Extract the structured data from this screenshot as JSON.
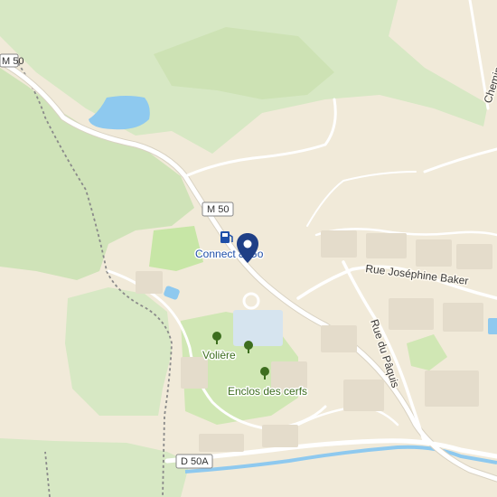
{
  "map": {
    "colors": {
      "land": "#f1ead9",
      "forest": "#d7e8c4",
      "forest_dark": "#c9e0b1",
      "park": "#d0e7b4",
      "water": "#8ec9ef",
      "road": "#ffffff",
      "pin": "#1f3f86",
      "station": "#1f4fa8",
      "poi_green": "#3d6e1f"
    },
    "road_shields": {
      "m50_top": "M 50",
      "m50_mid": "M 50",
      "d50a": "D 50A"
    },
    "station": {
      "icon": "fuel-pump-icon",
      "label": "Connect & Go"
    },
    "pin": {
      "icon": "map-pin-icon"
    },
    "streets": {
      "rue_josephine_baker": "Rue Joséphine Baker",
      "rue_du_paquis": "Rue du Pâquis",
      "chemin": "Chemin"
    },
    "pois": {
      "voliere": {
        "label": "Volière",
        "icon": "tree-icon"
      },
      "enclos": {
        "label": "Enclos des cerfs",
        "icon": "tree-icon"
      },
      "extra_tree": {
        "icon": "tree-icon"
      }
    }
  }
}
